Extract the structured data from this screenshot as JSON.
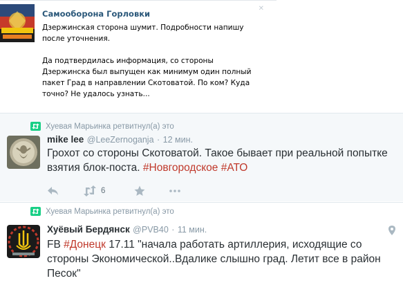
{
  "vk_post": {
    "author": "Самооборона Горловки",
    "paragraph1": "Дзержинская сторона шумит. Подробности напишу после уточнения.",
    "paragraph2": "Да подтвердилась информация, со стороны Дзержинска был выпущен как минимум один полный пакет Град в направлении Скотоватой. По ком? Куда точно? Не удалось узнать..."
  },
  "tweets": [
    {
      "retweet_label": "Хуевая Марьинка ретвитнул(а) это",
      "name": "mike lee",
      "handle": "@LeeZernoganja",
      "time": "12 мин.",
      "text_before": "Грохот со стороны Скотоватой. Такое бывает при реальной попытке взятия блок-поста. ",
      "hashtag1": "#Новгородское",
      "hashtag2": "#АТО",
      "retweet_count": "6"
    },
    {
      "retweet_label": "Хуевая Марьинка ретвитнул(а) это",
      "name": "Хуёвый Бердянск",
      "handle": "@PVB40",
      "time": "11 мин.",
      "text_prefix": "FB ",
      "hashtag": "#Донецк",
      "text_after": " 17.11 \"начала работать артиллерия, исходящие со стороны Экономической..Вдалике слышно град. Летит все в район Песок\""
    }
  ],
  "colors": {
    "vk_link": "#2b587a",
    "retweet_green": "#19cf86",
    "hashtag": "#c0392b",
    "muted": "#8899a6"
  }
}
